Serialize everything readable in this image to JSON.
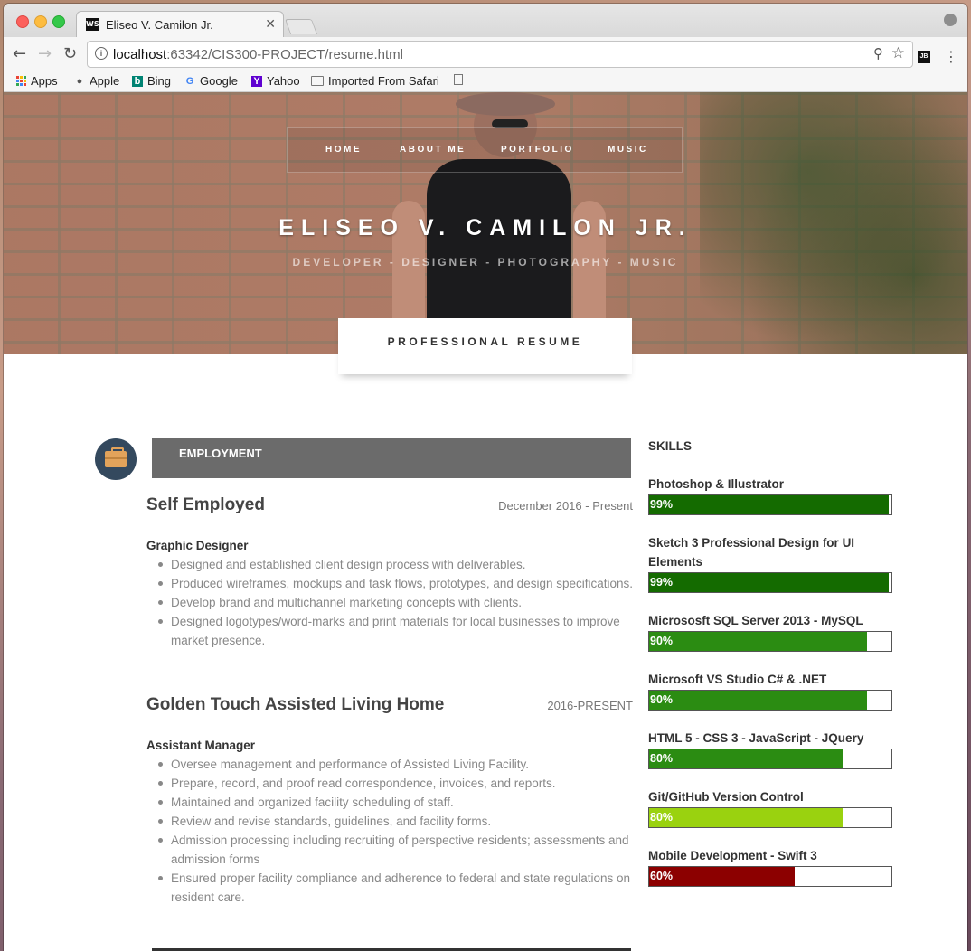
{
  "browser": {
    "tab_title": "Eliseo V. Camilon Jr.",
    "tab_favicon": "WS",
    "url_host": "localhost",
    "url_path": ":63342/CIS300-PROJECT/resume.html",
    "extension_label": "JB",
    "bookmarks": {
      "apps": "Apps",
      "apple": "Apple",
      "bing": "Bing",
      "google": "Google",
      "yahoo": "Yahoo",
      "imported": "Imported From Safari"
    }
  },
  "nav": {
    "home": "HOME",
    "about": "ABOUT ME",
    "portfolio": "PORTFOLIO",
    "music": "MUSIC"
  },
  "hero": {
    "title": "ELISEO V. CAMILON JR.",
    "subtitle": "DEVELOPER - DESIGNER - PHOTOGRAPHY - MUSIC"
  },
  "resume_tab": "PROFESSIONAL RESUME",
  "employment": {
    "heading": "EMPLOYMENT",
    "jobs": [
      {
        "company": "Self Employed",
        "date": "December 2016 - Present",
        "role": "Graphic Designer",
        "duties": [
          "Designed and established client design process with deliverables.",
          "Produced wireframes, mockups and task flows, prototypes, and design specifications.",
          "Develop brand and multichannel marketing concepts with clients.",
          "Designed logotypes/word-marks and print materials for local businesses to improve market presence."
        ]
      },
      {
        "company": "Golden Touch Assisted Living Home",
        "date": "2016-PRESENT",
        "role": "Assistant Manager",
        "duties": [
          "Oversee management and performance of Assisted Living Facility.",
          "Prepare, record, and proof read correspondence, invoices, and reports.",
          "Maintained and organized facility scheduling of staff.",
          "Review and revise standards, guidelines, and facility forms.",
          "Admission processing including recruiting of perspective residents; assessments and admission forms",
          "Ensured proper facility compliance and adherence to federal and state regulations on resident care."
        ]
      }
    ]
  },
  "skills": {
    "heading": "SKILLS",
    "items": [
      {
        "name": "Photoshop & Illustrator",
        "percent_label": "99%",
        "level": 0.99,
        "color": "#146b00"
      },
      {
        "name": "Sketch 3 Professional Design for UI Elements",
        "percent_label": "99%",
        "level": 0.99,
        "color": "#146b00"
      },
      {
        "name": "Micrososft SQL Server 2013 - MySQL",
        "percent_label": "90%",
        "level": 0.9,
        "color": "#2b8c12"
      },
      {
        "name": "Microsoft VS Studio C# & .NET",
        "percent_label": "90%",
        "level": 0.9,
        "color": "#2b8c12"
      },
      {
        "name": "HTML 5 - CSS 3 - JavaScript - JQuery",
        "percent_label": "80%",
        "level": 0.8,
        "color": "#2b8c12"
      },
      {
        "name": "Git/GitHub Version Control",
        "percent_label": "80%",
        "level": 0.8,
        "color": "#9ad20f"
      },
      {
        "name": "Mobile Development - Swift 3",
        "percent_label": "60%",
        "level": 0.6,
        "color": "#8c0000"
      }
    ]
  }
}
